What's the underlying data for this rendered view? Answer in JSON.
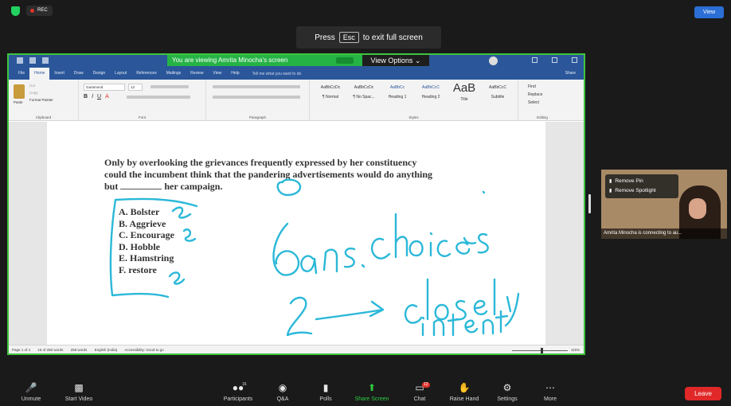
{
  "top": {
    "rec_label": "REC",
    "view_label": "View"
  },
  "esc": {
    "press": "Press",
    "key": "Esc",
    "rest": "to exit full screen"
  },
  "word": {
    "share_banner": "You are viewing Amrita Minocha's screen",
    "view_options": "View Options",
    "tabs": [
      "File",
      "Home",
      "Insert",
      "Draw",
      "Design",
      "Layout",
      "References",
      "Mailings",
      "Review",
      "View",
      "Help"
    ],
    "tell_me": "Tell me what you want to do",
    "share": "Share",
    "groups": [
      "Clipboard",
      "Font",
      "Paragraph",
      "Styles",
      "Editing"
    ],
    "clipboard": {
      "paste": "Paste",
      "cut": "Cut",
      "copy": "Copy",
      "format_painter": "Format Painter"
    },
    "font": {
      "name": "Garamond",
      "size": "12"
    },
    "styles": [
      {
        "preview": "AaBbCcDc",
        "name": "¶ Normal"
      },
      {
        "preview": "AaBbCcDc",
        "name": "¶ No Spac..."
      },
      {
        "preview": "AaBbCc",
        "name": "Heading 1"
      },
      {
        "preview": "AaBbCcC",
        "name": "Heading 2"
      },
      {
        "preview": "AaB",
        "name": "Title"
      },
      {
        "preview": "AaBbCcC",
        "name": "Subtitle"
      }
    ],
    "editing": [
      "Find",
      "Replace",
      "Select"
    ],
    "question": {
      "part1": "Only by overlooking the grievances frequently expressed by her constituency could the incumbent think that the pandering advertisements would do anything",
      "but": "but",
      "part2": "her campaign."
    },
    "options": [
      "A. Bolster",
      "B. Aggrieve",
      "C. Encourage",
      "D. Hobble",
      "E. Hamstring",
      "F. restore"
    ],
    "status": {
      "page": "Page 1 of 4",
      "words": "16 of 258 words",
      "doc_words": "258 words",
      "language": "English (India)",
      "accessibility": "Accessibility: Good to go",
      "zoom": "115%"
    }
  },
  "participant": {
    "menu": [
      "Remove Pin",
      "Remove Spotlight"
    ],
    "name": "Amrita Minocha is connecting to au..."
  },
  "toolbar": {
    "items": [
      "Unmute",
      "Start Video",
      "Participants",
      "Q&A",
      "Polls",
      "Share Screen",
      "Chat",
      "Raise Hand",
      "Settings",
      "More"
    ],
    "participants_count": "16",
    "chat_count": "12",
    "leave": "Leave"
  }
}
